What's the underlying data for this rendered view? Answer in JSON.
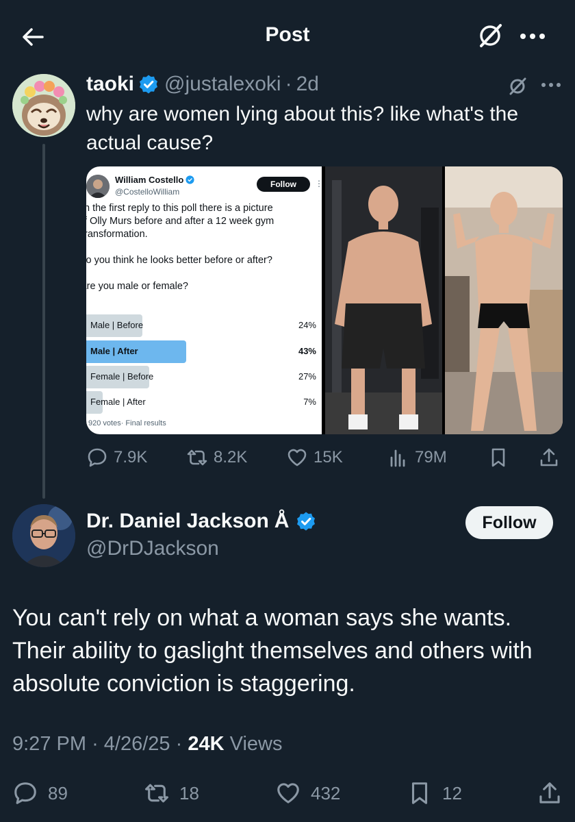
{
  "header": {
    "title": "Post"
  },
  "quoted_tweet": {
    "display_name": "taoki",
    "handle": "@justalexoki",
    "separator": "·",
    "time": "2d",
    "text": "why are women lying about this? like what's the actual cause?",
    "media": {
      "poll_screenshot": {
        "author_name": "William Costello",
        "author_handle": "@CostelloWilliam",
        "follow_label": "Follow",
        "body_lines": [
          "n the first reply to this poll there is a picture",
          "f Olly Murs before and after a 12 week gym",
          "ransformation."
        ],
        "question_1": "Do you think he looks better before or after?",
        "question_2": "Are you male or female?",
        "options": [
          {
            "label": "Male | Before",
            "percent": "24%",
            "fraction": 0.24
          },
          {
            "label": "Male | After",
            "percent": "43%",
            "fraction": 0.43
          },
          {
            "label": "Female | Before",
            "percent": "27%",
            "fraction": 0.27
          },
          {
            "label": "Female | After",
            "percent": "7%",
            "fraction": 0.07
          }
        ],
        "footer": "920 votes· Final results"
      }
    },
    "stats": {
      "replies": "7.9K",
      "reposts": "8.2K",
      "likes": "15K",
      "views": "79M"
    }
  },
  "main_tweet": {
    "display_name": "Dr. Daniel Jackson",
    "name_symbol": "Å",
    "handle": "@DrDJackson",
    "follow_label": "Follow",
    "text": "You can't rely on what a woman says she wants. Their ability to gaslight themselves and others with absolute conviction is staggering.",
    "time": "9:27 PM",
    "date": "4/26/25",
    "separator": "·",
    "views_count": "24K",
    "views_label": "Views",
    "stats": {
      "replies": "89",
      "reposts": "18",
      "likes": "432",
      "bookmarks": "12"
    }
  },
  "colors": {
    "background": "#15202b",
    "text_primary": "#f7f9f9",
    "text_secondary": "#8b98a5",
    "verified_blue": "#1d9bf0",
    "poll_winner": "#6db7ee",
    "poll_bar": "#cfd9de"
  },
  "icons": [
    "back-arrow-icon",
    "grok-icon",
    "more-icon",
    "verified-badge-icon",
    "reply-icon",
    "repost-icon",
    "like-icon",
    "views-icon",
    "bookmark-icon",
    "share-icon"
  ]
}
